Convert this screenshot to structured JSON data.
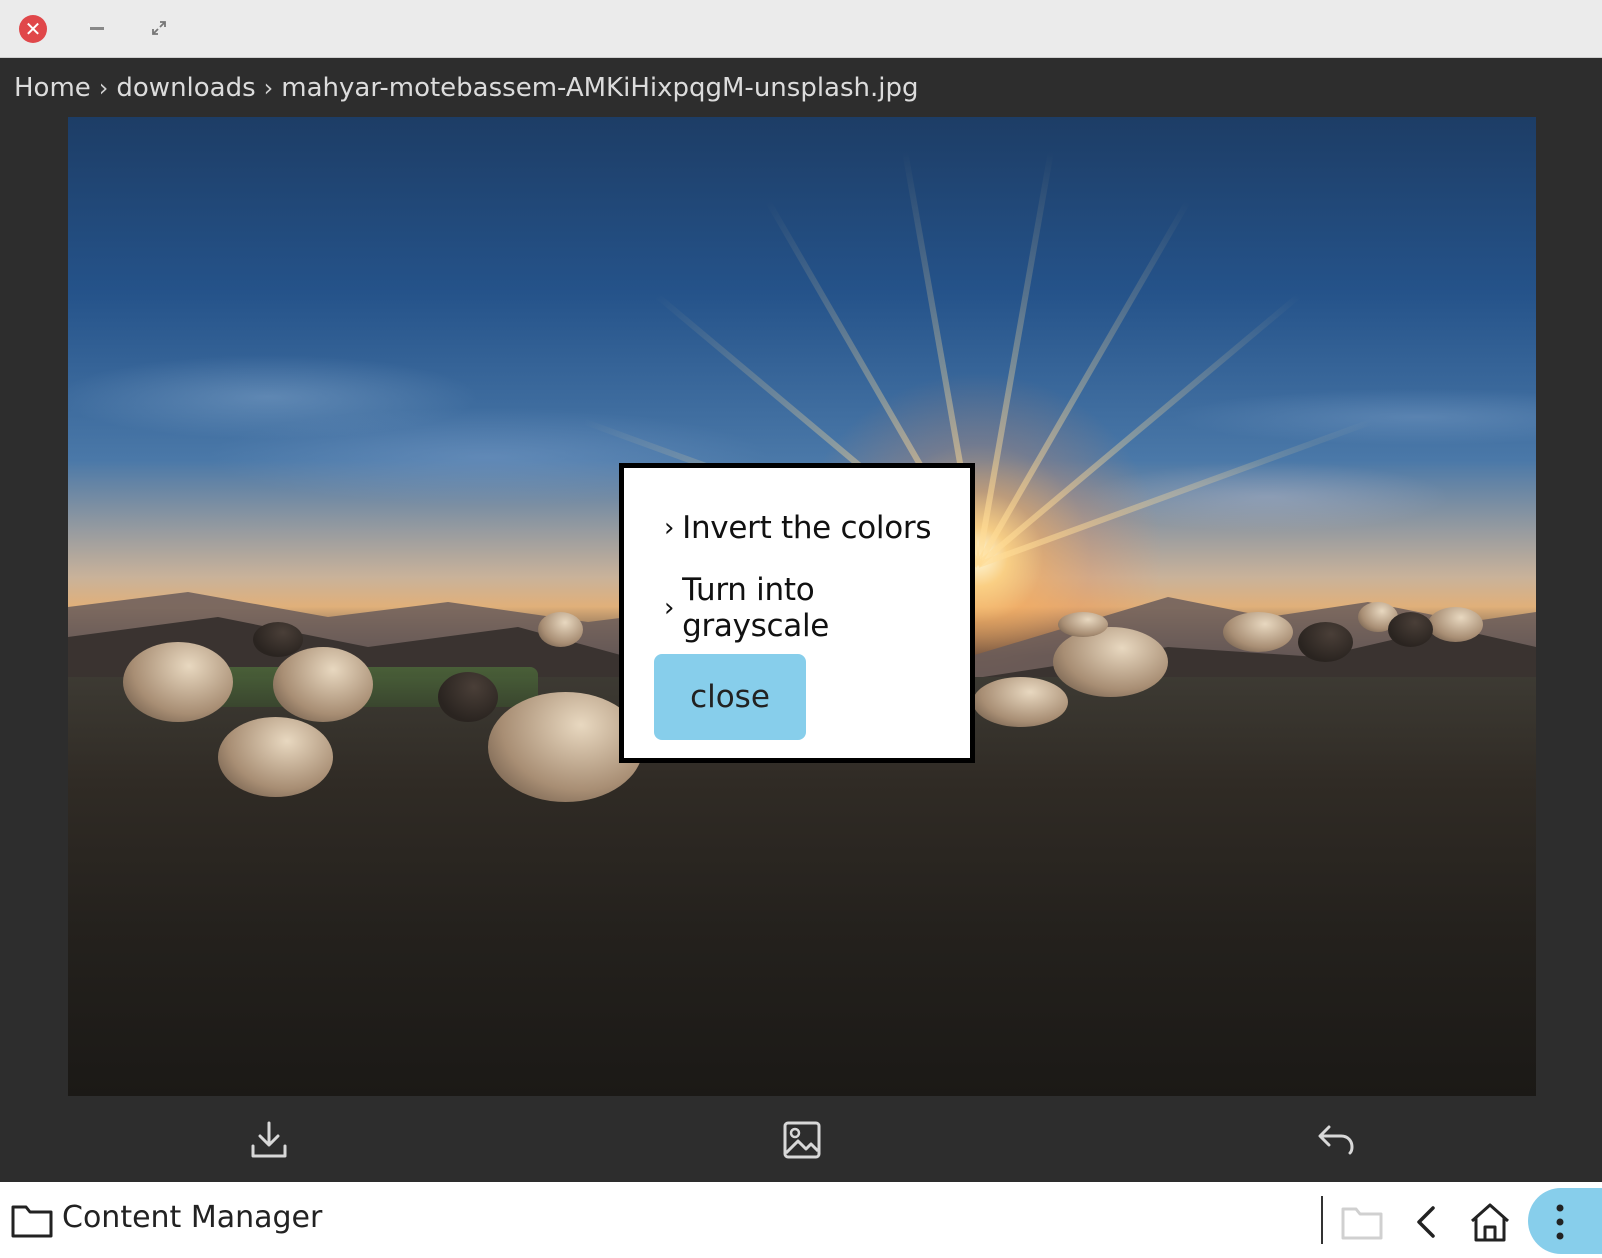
{
  "titlebar": {
    "title": "",
    "close_glyph": "✕"
  },
  "breadcrumb": {
    "items": [
      "Home",
      "downloads",
      "mahyar-motebassem-AMKiHixpqgM-unsplash.jpg"
    ],
    "separator": "›"
  },
  "dialog": {
    "option_1": "Invert the colors",
    "option_2": "Turn into grayscale",
    "chevron": "›",
    "close_label": "close",
    "close_color": "#87ceeb"
  },
  "toolbar": {
    "icons": [
      "download-icon",
      "image-icon",
      "undo-icon"
    ]
  },
  "bottombar": {
    "app_title": "Content Manager",
    "icons": [
      "folder-icon",
      "folder-disabled-icon",
      "back-icon",
      "home-icon",
      "more-vertical-icon"
    ],
    "accent": "#87ceeb"
  }
}
